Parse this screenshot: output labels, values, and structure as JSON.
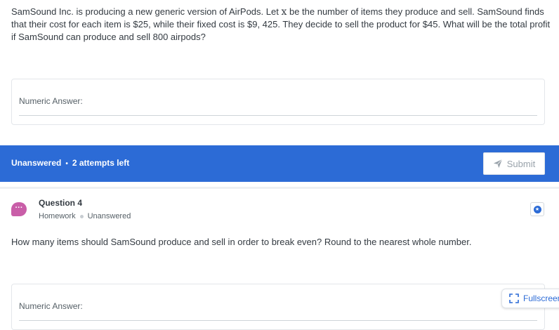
{
  "question3": {
    "text_before_var": "SamSound Inc. is producing a new generic version of AirPods. Let ",
    "variable": "x",
    "text_after_var": " be the number of items they produce and sell. SamSound finds that their cost for each item is $25, while their fixed cost is $9, 425. They decide to sell the product for $45. What will be the total profit if SamSound can produce and sell 800 airpods?",
    "answer_label": "Numeric Answer:"
  },
  "status_bar": {
    "status": "Unanswered",
    "separator": "•",
    "attempts": "2 attempts left",
    "submit_label": "Submit"
  },
  "question4": {
    "avatar_glyph": "···",
    "title": "Question 4",
    "category": "Homework",
    "status": "Unanswered",
    "text": "How many items should SamSound produce and sell in order to break even? Round to the nearest whole number.",
    "answer_label": "Numeric Answer:"
  },
  "fullscreen_label": "Fullscreen",
  "colors": {
    "accent": "#2c6bd6",
    "avatar": "#c95ea8"
  }
}
